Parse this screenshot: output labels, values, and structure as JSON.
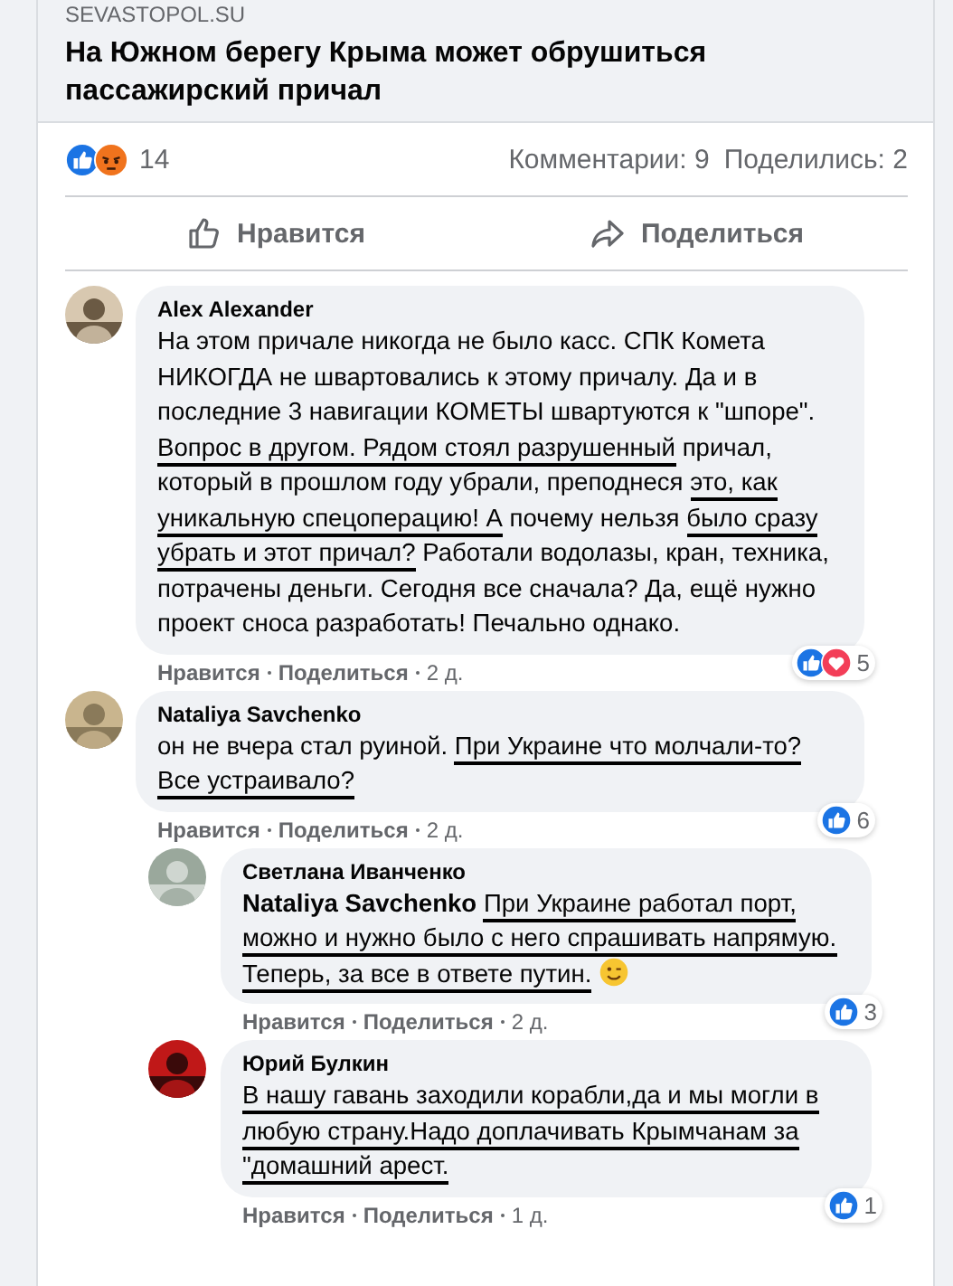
{
  "preview": {
    "source": "SEVASTOPOL.SU",
    "title": "На Южном берегу Крыма может обрушиться пассажирский причал"
  },
  "post_stats": {
    "reactions": [
      {
        "kind": "like"
      },
      {
        "kind": "angry"
      }
    ],
    "reaction_count": "14",
    "comments": "Комментарии: 9",
    "shares": "Поделились: 2"
  },
  "actions": [
    {
      "kind": "like",
      "label": "Нравится"
    },
    {
      "kind": "share",
      "label": "Поделиться"
    }
  ],
  "comments": [
    {
      "author": "Alex Alexander",
      "segments": [
        {
          "text": "На этом причале никогда не было касс. СПК Комета НИКОГДА не швартовались к этому причалу. Да и в последние 3 навигации КОМЕТЫ швартуются к \"шпоре\".",
          "underlined": false
        },
        {
          "text": " Вопрос в другом. Рядом стоял разрушенный",
          "underlined": true
        },
        {
          "text": " причал, который в прошлом году убрали, преподнеся ",
          "underlined": false
        },
        {
          "text": "это, как уникальную спецоперацию! А",
          "underlined": true
        },
        {
          "text": " почему нельзя ",
          "underlined": false
        },
        {
          "text": "было сразу убрать и этот причал?",
          "underlined": true
        },
        {
          "text": " Работали водолазы, кран, техника, потрачены деньги. Сегодня все сначала? Да, ещё нужно проект сноса разработать! Печально однако.",
          "underlined": false
        }
      ],
      "like": "Нравится",
      "share": "Поделиться",
      "time": "2 д.",
      "reactions": [
        {
          "kind": "like"
        },
        {
          "kind": "love"
        }
      ],
      "reaction_count": "5"
    },
    {
      "author": "Nataliya Savchenko",
      "segments": [
        {
          "text": "он не вчера стал руиной. ",
          "underlined": false
        },
        {
          "text": "При Украине что молчали-то? Все устраивало?",
          "underlined": true
        }
      ],
      "like": "Нравится",
      "share": "Поделиться",
      "time": "2 д.",
      "reactions": [
        {
          "kind": "like"
        }
      ],
      "reaction_count": "6",
      "children": [
        {
          "author": "Светлана Иванченко",
          "segments": [
            {
              "text": "**Nataliya Savchenko** ",
              "underlined": false
            },
            {
              "text": "При Украине работал порт, можно и нужно было с него спрашивать напрямую. Теперь, за все в ответе путин.",
              "underlined": true
            }
          ],
          "emoji": {
            "kind": "wink"
          },
          "like": "Нравится",
          "share": "Поделиться",
          "time": "2 д.",
          "reactions": [
            {
              "kind": "like"
            }
          ],
          "reaction_count": "3"
        },
        {
          "author": "Юрий Булкин",
          "segments": [
            {
              "text": "В нашу гавань заходили корабли,да и мы могли в любую страну.Надо доплачивать Крымчанам за \"домашний арест.",
              "underlined": true
            }
          ],
          "like": "Нравится",
          "share": "Поделиться",
          "time": "1 д.",
          "reactions": [
            {
              "kind": "like"
            }
          ],
          "reaction_count": "1"
        }
      ]
    }
  ]
}
